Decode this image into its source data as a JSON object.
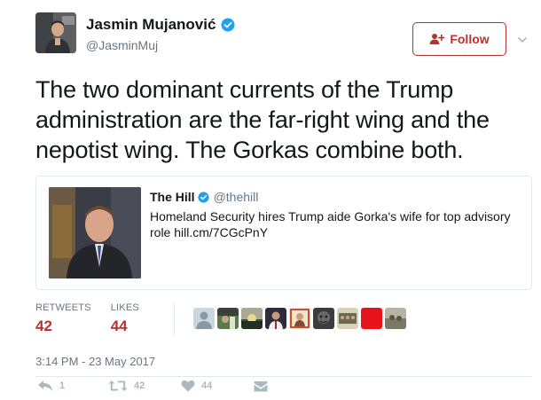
{
  "author": {
    "display_name": "Jasmin Mujanović",
    "handle": "@JasminMuj",
    "verified": true,
    "avatar_icon": "profile-photo"
  },
  "follow_button": {
    "label": "Follow",
    "icon": "add-person-icon",
    "color": "#b5322e"
  },
  "tweet": {
    "text": "The two dominant currents of the Trump administration are the far-right wing and the nepotist wing. The Gorkas combine both.",
    "timestamp": "3:14 PM - 23 May 2017"
  },
  "quoted_tweet": {
    "name": "The Hill",
    "handle": "@thehill",
    "verified": true,
    "text": "Homeland Security hires Trump aide Gorka's wife for top advisory role hill.cm/7CGcPnY",
    "image_icon": "news-photo"
  },
  "stats": {
    "retweets_label": "RETWEETS",
    "retweets_value": "42",
    "likes_label": "LIKES",
    "likes_value": "44"
  },
  "likers": [
    {
      "name": "liker-avatar-1",
      "color": "#ccd6dd"
    },
    {
      "name": "liker-avatar-2",
      "color": "#5a7a4e"
    },
    {
      "name": "liker-avatar-3",
      "color": "#7a8a6a"
    },
    {
      "name": "liker-avatar-4",
      "color": "#2e2e3a"
    },
    {
      "name": "liker-avatar-5",
      "color": "#c84c3a"
    },
    {
      "name": "liker-avatar-6",
      "color": "#3c3c3c"
    },
    {
      "name": "liker-avatar-7",
      "color": "#6a6a52"
    },
    {
      "name": "liker-avatar-8",
      "color": "#e8121b"
    },
    {
      "name": "liker-avatar-9",
      "color": "#7c7866"
    }
  ],
  "actions": {
    "reply_count": "1",
    "retweet_count": "42",
    "like_count": "44",
    "reply_icon": "reply-icon",
    "retweet_icon": "retweet-icon",
    "like_icon": "heart-icon",
    "dm_icon": "direct-message-icon"
  },
  "colors": {
    "accent": "#b5322e",
    "verified_blue": "#1da1f2",
    "muted_text": "#657786",
    "action_icon": "#aab8c2"
  }
}
